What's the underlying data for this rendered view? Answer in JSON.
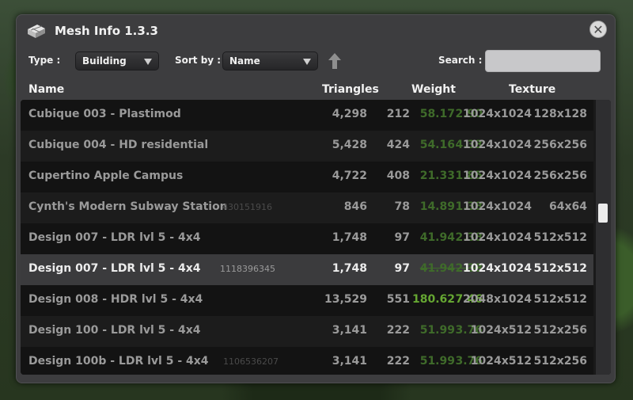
{
  "window": {
    "title": "Mesh Info 1.3.3",
    "close_symbol": "✕"
  },
  "filters": {
    "type_label": "Type :",
    "type_value": "Building",
    "sort_label": "Sort by :",
    "sort_value": "Name",
    "search_label": "Search :",
    "search_value": ""
  },
  "columns": {
    "name": "Name",
    "triangles": "Triangles",
    "weight": "Weight",
    "texture": "Texture"
  },
  "rows": [
    {
      "name": "Cubique 003 - Plastimod",
      "id": "",
      "tri": "4,298",
      "tri_lod": "212",
      "weight": "58.17",
      "weight_lod": "2.90",
      "tex": "1024x1024",
      "tex_lod": "128x128"
    },
    {
      "name": "Cubique 004 - HD residential",
      "id": "",
      "tri": "5,428",
      "tri_lod": "424",
      "weight": "54.16",
      "weight_lod": "4.33",
      "tex": "1024x1024",
      "tex_lod": "256x256"
    },
    {
      "name": "Cupertino Apple Campus",
      "id": "",
      "tri": "4,722",
      "tri_lod": "408",
      "weight": "21.33",
      "weight_lod": "1.85",
      "tex": "1024x1024",
      "tex_lod": "256x256"
    },
    {
      "name": "Cynth's Modern Subway Station",
      "id": "430151916",
      "tri": "846",
      "tri_lod": "78",
      "weight": "14.89",
      "weight_lod": "1.38",
      "tex": "1024x1024",
      "tex_lod": "64x64"
    },
    {
      "name": "Design 007 - LDR lvl 5 - 4x4",
      "id": "",
      "tri": "1,748",
      "tri_lod": "97",
      "weight": "41.94",
      "weight_lod": "2.38",
      "tex": "1024x1024",
      "tex_lod": "512x512"
    },
    {
      "name": "Design 007 - LDR lvl 5 - 4x4",
      "id": "1118396345",
      "tri": "1,748",
      "tri_lod": "97",
      "weight": "41.94",
      "weight_lod": "2.38",
      "tex": "1024x1024",
      "tex_lod": "512x512"
    },
    {
      "name": "Design 008 - HDR lvl 5 - 4x4",
      "id": "",
      "tri": "13,529",
      "tri_lod": "551",
      "weight": "180.62",
      "weight_lod": "7.46",
      "tex": "2048x1024",
      "tex_lod": "512x512"
    },
    {
      "name": "Design 100 - LDR lvl 5 - 4x4",
      "id": "",
      "tri": "3,141",
      "tri_lod": "222",
      "weight": "51.99",
      "weight_lod": "3.76",
      "tex": "1024x512",
      "tex_lod": "512x256"
    },
    {
      "name": "Design 100b - LDR lvl 5 - 4x4",
      "id": "1106536207",
      "tri": "3,141",
      "tri_lod": "222",
      "weight": "51.99",
      "weight_lod": "3.76",
      "tex": "1024x512",
      "tex_lod": "512x256"
    }
  ],
  "colors": {
    "accent_green": "#65a632",
    "dim_green": "#3f6b2a",
    "panel": "#3d3d3f"
  },
  "icons": {
    "title": "mesh-info-icon",
    "close": "close-icon",
    "dropdown": "chevron-down-icon",
    "sort": "sort-direction-arrow-icon"
  }
}
